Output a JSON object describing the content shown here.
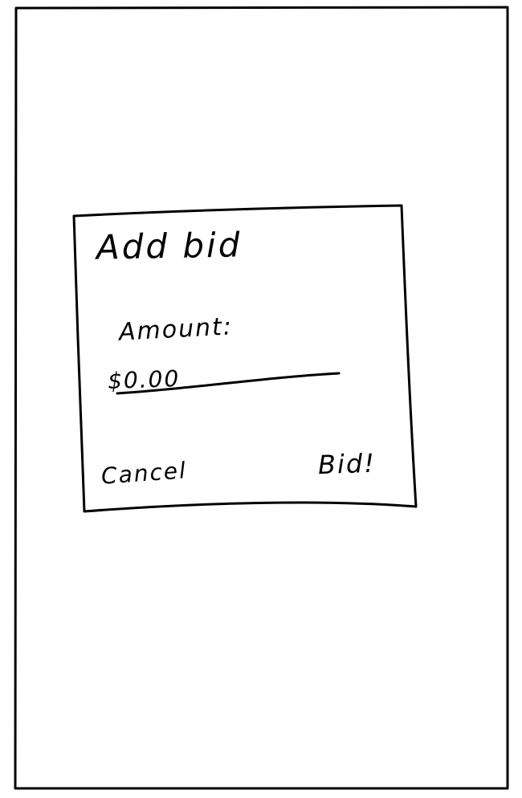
{
  "dialog": {
    "title": "Add bid",
    "amount_label": "Amount:",
    "amount_value": "$0.00",
    "cancel_label": "Cancel",
    "bid_label": "Bid!"
  }
}
